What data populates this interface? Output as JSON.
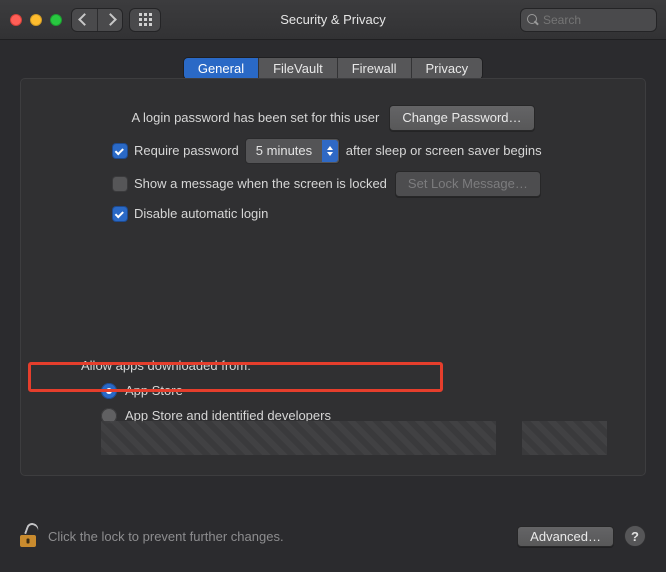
{
  "window": {
    "title": "Security & Privacy",
    "search_placeholder": "Search"
  },
  "tabs": {
    "general": "General",
    "filevault": "FileVault",
    "firewall": "Firewall",
    "privacy": "Privacy"
  },
  "general": {
    "login_pw_set_label": "A login password has been set for this user",
    "change_password_btn": "Change Password…",
    "require_password_label_pre": "Require password",
    "require_password_delay": "5 minutes",
    "require_password_label_post": "after sleep or screen saver begins",
    "show_message_label": "Show a message when the screen is locked",
    "set_lock_message_btn": "Set Lock Message…",
    "disable_auto_login_label": "Disable automatic login",
    "allow_apps_header": "Allow apps downloaded from:",
    "radio_app_store": "App Store",
    "radio_app_store_dev": "App Store and identified developers"
  },
  "footer": {
    "lock_hint": "Click the lock to prevent further changes.",
    "advanced_btn": "Advanced…",
    "help": "?"
  }
}
